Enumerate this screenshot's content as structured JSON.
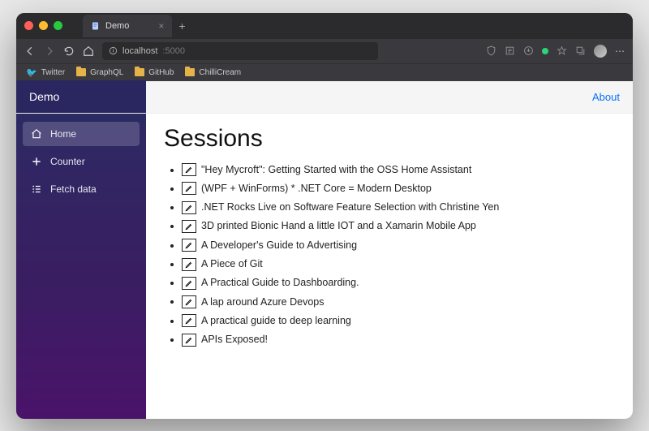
{
  "browser": {
    "tab_title": "Demo",
    "url_host": "localhost",
    "url_port": ":5000",
    "bookmarks": [
      "Twitter",
      "GraphQL",
      "GitHub",
      "ChilliCream"
    ]
  },
  "header": {
    "brand": "Demo",
    "about": "About"
  },
  "sidebar": {
    "items": [
      {
        "label": "Home",
        "icon": "home-icon",
        "active": true
      },
      {
        "label": "Counter",
        "icon": "plus-icon",
        "active": false
      },
      {
        "label": "Fetch data",
        "icon": "list-icon",
        "active": false
      }
    ]
  },
  "page": {
    "title": "Sessions",
    "sessions": [
      "\"Hey Mycroft\": Getting Started with the OSS Home Assistant",
      "(WPF + WinForms) * .NET Core = Modern Desktop",
      ".NET Rocks Live on Software Feature Selection with Christine Yen",
      "3D printed Bionic Hand a little IOT and a Xamarin Mobile App",
      "A Developer's Guide to Advertising",
      "A Piece of Git",
      "A Practical Guide to Dashboarding.",
      "A lap around Azure Devops",
      "A practical guide to deep learning",
      "APIs Exposed!"
    ]
  }
}
